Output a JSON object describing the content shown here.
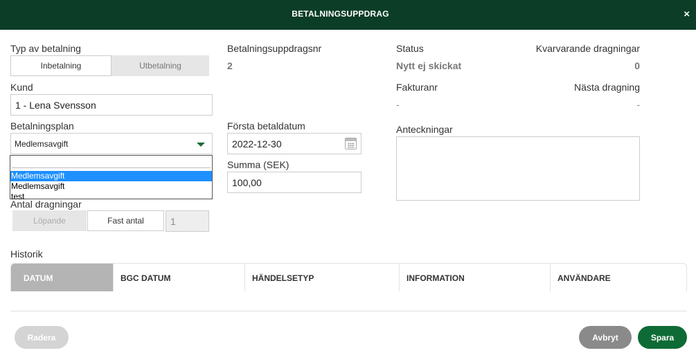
{
  "dialog": {
    "title": "BETALNINGSUPPDRAG",
    "close_label": "×"
  },
  "payment_type": {
    "label": "Typ av betalning",
    "options": [
      "Inbetalning",
      "Utbetalning"
    ],
    "selected": "Inbetalning"
  },
  "order_number": {
    "label": "Betalningsuppdragsnr",
    "value": "2"
  },
  "status": {
    "label": "Status",
    "value": "Nytt ej skickat"
  },
  "remaining": {
    "label": "Kvarvarande dragningar",
    "value": "0"
  },
  "customer": {
    "label": "Kund",
    "value": "1 - Lena Svensson"
  },
  "invoice": {
    "label": "Fakturanr",
    "value": "-"
  },
  "next_draw": {
    "label": "Nästa dragning",
    "value": "-"
  },
  "plan": {
    "label": "Betalningsplan",
    "value": "Medlemsavgift",
    "options": [
      "Medlemsavgift",
      "Medlemsavgift",
      "test"
    ],
    "highlighted_index": 0
  },
  "first_date": {
    "label": "Första betaldatum",
    "value": "2022-12-30"
  },
  "notes": {
    "label": "Anteckningar",
    "value": ""
  },
  "amount": {
    "label": "Summa (SEK)",
    "value": "100,00"
  },
  "draw_count": {
    "label": "Antal dragningar",
    "options": [
      "Löpande",
      "Fast antal"
    ],
    "selected": "Fast antal",
    "value": "1"
  },
  "history": {
    "label": "Historik",
    "columns": [
      "DATUM",
      "BGC DATUM",
      "HÄNDELSETYP",
      "INFORMATION",
      "ANVÄNDARE"
    ]
  },
  "footer": {
    "delete_label": "Radera",
    "cancel_label": "Avbryt",
    "save_label": "Spara"
  },
  "colors": {
    "header": "#0b3d27",
    "save": "#0e6b35",
    "cancel": "#8a8a8a",
    "disabled": "#d4d4d4"
  }
}
